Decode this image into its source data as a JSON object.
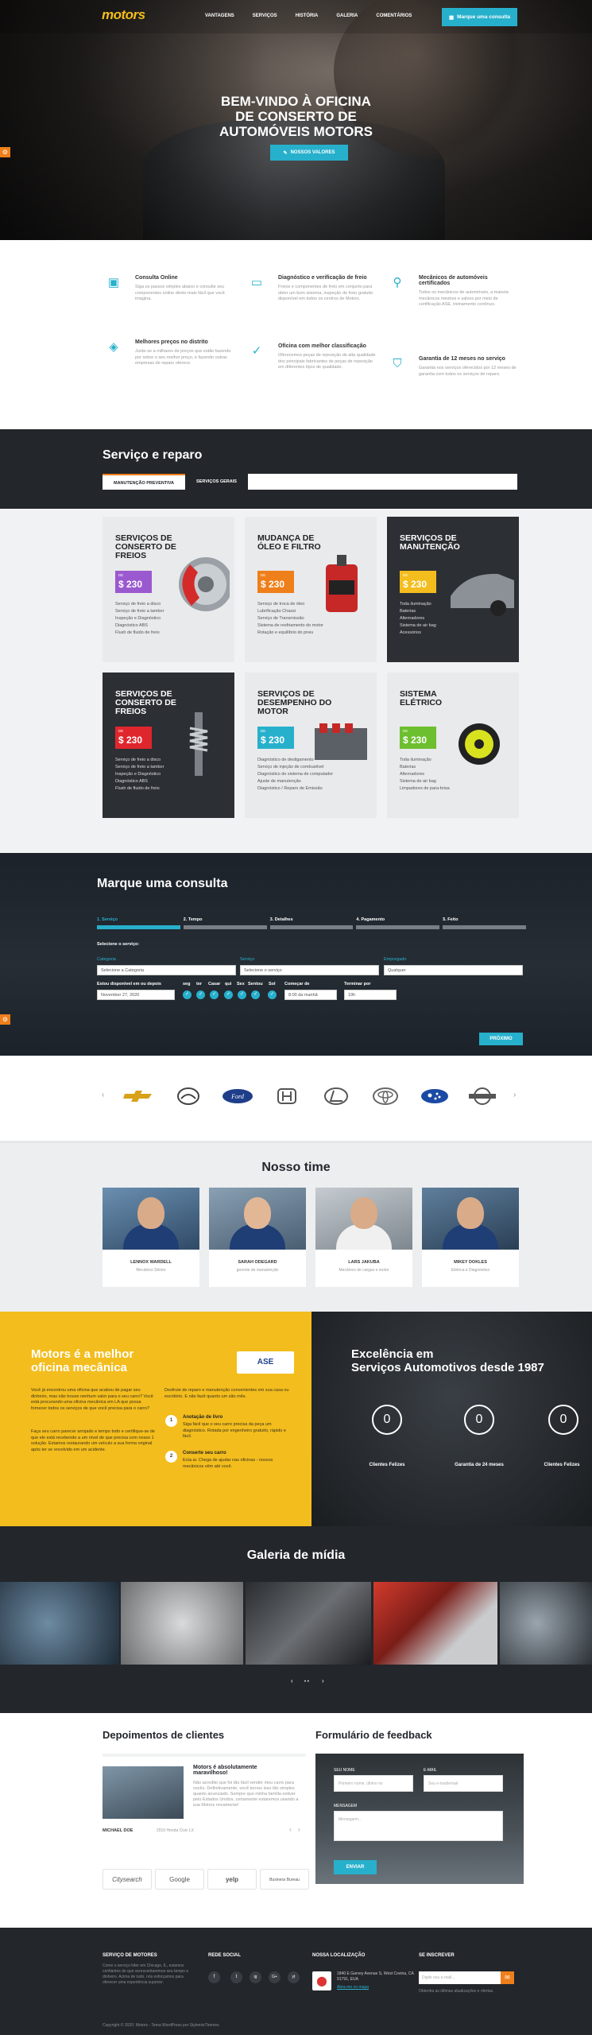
{
  "nav": {
    "logo": "motors",
    "items": [
      "VANTAGENS",
      "SERVIÇOS",
      "HISTÓRIA",
      "GALERIA",
      "COMENTÁRIOS"
    ],
    "cta": "Marque uma consulta"
  },
  "hero": {
    "title_l1": "BEM-VINDO À OFICINA",
    "title_l2": "DE CONSERTO DE",
    "title_l3": "AUTOMÓVEIS MOTORS",
    "button": "NOSSOS VALORES"
  },
  "features": [
    {
      "icon": "calendar-icon",
      "title": "Consulta Online",
      "text": "Siga os passos simples abaixo e consulte seu componentes online direto mais fácil que você imagina."
    },
    {
      "icon": "diagnostic-icon",
      "title": "Diagnóstico e verificação de freio",
      "text": "Freios e componentes de freio em conjunto para obter um bom sistema, inspeção de freio gratuito disponível em todos os centros de Motors."
    },
    {
      "icon": "mechanic-icon",
      "title": "Mecânicos de automóveis certificados",
      "text": "Todos os mecânicos de automóveis, a maioria mecânicos mestres e salvos por meio de certificação ASE, treinamento contínuo."
    },
    {
      "icon": "price-tag-icon",
      "title": "Melhores preços no distrito",
      "text": "Junte-se a milhares de preços que estão fazendo por sobre o seu melhor preço, e fazendo outras empresas de reparo oferece."
    },
    {
      "icon": "thumbs-up-icon",
      "title": "Oficina com melhor classificação",
      "text": "Oferecemos peças de reposição de alta qualidade dos principais fabricantes de peças de reposição em diferentes tipos de qualidade."
    },
    {
      "icon": "shield-icon",
      "title": "Garantia de 12 meses no serviço",
      "text": "Garantia nos serviços oferecidos por 12 meses de garantia com todos os serviços de reparo."
    }
  ],
  "service": {
    "title": "Serviço e reparo",
    "tabs": [
      "MANUTENÇÃO PREVENTIVA",
      "SERVIÇOS GERAIS"
    ],
    "price_prefix": "DE",
    "cards": [
      {
        "title": "SERVIÇOS DE CONSERTO DE FREIOS",
        "price": "$ 230",
        "color": "#9b59d0",
        "items": [
          "Serviço de freio a disco",
          "Serviço de freio a tambor",
          "Inspeção e Diagnóstico",
          "Diagnóstico ABS",
          "Flush de fluido de freio"
        ]
      },
      {
        "title": "MUDANÇA DE ÓLEO E FILTRO",
        "price": "$ 230",
        "color": "#ef7f1a",
        "items": [
          "Serviço de troca de óleo",
          "Lubrificação Chassi",
          "Serviço de Transmissão",
          "Sistema de resfriamento do motor",
          "Rotação e equilíbrio do pneu"
        ]
      },
      {
        "title": "SERVIÇOS DE MANUTENÇÃO",
        "price": "$ 230",
        "color": "#f3bd1d",
        "items": [
          "Toda iluminação",
          "Baterias",
          "Alternadores",
          "Sistema de air bag",
          "Acessórios"
        ]
      },
      {
        "title": "SERVIÇOS DE CONSERTO DE FREIOS",
        "price": "$ 230",
        "color": "#e0262d",
        "items": [
          "Serviço de freio a disco",
          "Serviço de freio a tambor",
          "Inspeção e Diagnóstico",
          "Diagnóstico ABS",
          "Flush de fluido de freio"
        ]
      },
      {
        "title": "SERVIÇOS DE DESEMPENHO DO MOTOR",
        "price": "$ 230",
        "color": "#27b0cc",
        "items": [
          "Diagnóstico de desligamento",
          "Serviço de injeção de combustível",
          "Diagnóstico de sistema de computador",
          "Ajuste de manutenção",
          "Diagnóstico / Reparo de Emissão"
        ]
      },
      {
        "title": "SISTEMA ELÉTRICO",
        "price": "$ 230",
        "color": "#6cbf2e",
        "items": [
          "Toda iluminação",
          "Baterias",
          "Alternadores",
          "Sistema de air bag",
          "Limpadores de para-brisa"
        ]
      }
    ]
  },
  "booking": {
    "title": "Marque uma consulta",
    "steps": [
      "1. Serviço",
      "2. Tempo",
      "3. Detalhes",
      "4. Pagamento",
      "5. Feito"
    ],
    "select_label": "Selecione o serviço:",
    "category_label": "Categoria",
    "category_value": "Selecione a Categoria",
    "service_label": "Serviço",
    "service_value": "Selecione o serviço",
    "employee_label": "Empregado",
    "employee_value": "Qualquer",
    "available_label": "Estou disponível em ou depois",
    "date_value": "November 27, 2020",
    "days": [
      "seg",
      "ter",
      "Casar",
      "qui",
      "Sex",
      "Sentou",
      "Sol"
    ],
    "start_label": "Começar de",
    "start_value": "8:00 da manhã",
    "end_label": "Terminar por",
    "end_value": "19h",
    "next": "PRÓXIMO"
  },
  "brands": [
    "chevrolet-logo",
    "mazda-logo",
    "ford-logo",
    "honda-logo",
    "lexus-logo",
    "toyota-logo",
    "subaru-logo",
    "nissan-logo"
  ],
  "team": {
    "title": "Nosso time",
    "members": [
      {
        "name": "LENNOX WARDELL",
        "role": "Mecânico Sênior"
      },
      {
        "name": "SARAH ODEGARD",
        "role": "gerente de manutenção"
      },
      {
        "name": "LARS JAKUBA",
        "role": "Mecânico de cargas e motor"
      },
      {
        "name": "MIKEY DOKLES",
        "role": "Elétrica e Diagnóstico"
      }
    ]
  },
  "about": {
    "title_l1": "Motors é a melhor",
    "title_l2": "oficina mecânica",
    "badge": "ASE",
    "p1": "Você já encontrou uma oficina que acabou de pagar seu dinheiro, mas não trouxe nenhum valor para o seu carro? Você está procurando uma oficina mecânica em LA que possa fornecer todos os serviços de que você precisa para o carro?",
    "p2": "Faça seu carro parecer arrojado e tempo todo e certifique-se de que ele está recebendo a um nível de que precisa com nosso 1 solução. Estamos restaurando um veículo a sua forma original após ter se envolvido em um acidente.",
    "p3": "Desfrute de reparo e manutenção convenientes em sua casa ou escritório. E não fazê quanto um são mês.",
    "step1_title": "Anotação de livro",
    "step1_text": "Siga fácil que o seu carro precisa da peça um diagnóstico. Rotada por engenheiro gratuito, rápido e fácil.",
    "step2_title": "Conserte seu carro",
    "step2_text": "Ecta ai. Chega de ajudar nas oficinas - nossos mecânicos vêm até você.",
    "right_l1": "Excelência em",
    "right_l2": "Serviços Automotivos desde 1987",
    "stats": [
      {
        "value": "0",
        "label": "Clientes Felizes"
      },
      {
        "value": "0",
        "label": "Garantia de 24 meses"
      },
      {
        "value": "0",
        "label": "Clientes Felizes"
      }
    ]
  },
  "media": {
    "title": "Galeria de mídia"
  },
  "testimonials": {
    "title": "Depoimentos de clientes",
    "quote_title": "Motors é absolutamente maravilhoso!",
    "quote": "Não acredito que foi tão fácil vender meu carro para vocês. Definitivamente, você tornou isso tão simples quanto anunciado. Sempre que minha família estiver pelo Estados Unidos, certamente estaremos usando a sua Motors novamente!",
    "author": "MICHAEL DOE",
    "car": "2010 Honda Civic LX",
    "logos": [
      "Citysearch",
      "Google",
      "yelp",
      "Business Bureau"
    ]
  },
  "feedback": {
    "title": "Formulário de feedback",
    "name_label": "SEU NOME",
    "name_ph": "Primeiro nome, último no",
    "email_label": "E-MAIL",
    "email_ph": "Seu e-mail/email",
    "msg_label": "MENSAGEM",
    "msg_ph": "Mensagem...",
    "send": "ENVIAR"
  },
  "footer": {
    "col1_title": "SERVIÇO DE MOTORES",
    "col1_text": "Como o serviço líder em Chicago, IL, estamos confiantes de que acrescentaremos seu tempo e dinheiro. Acima de tudo, nós esforçamos para oferecer uma experiência superior.",
    "col2_title": "REDE SOCIAL",
    "socials": [
      "f",
      "t",
      "ig",
      "G+",
      "yt"
    ],
    "col3_title": "NOSSA LOCALIZAÇÃO",
    "address": "1840 E Garvey Avenue S, West Covina, CA 91791, EUA",
    "map_link": "Abra-mo no mapa",
    "col4_title": "SE INSCREVER",
    "email_ph": "Digite seu e-mail...",
    "sub_text": "Obtenha as últimas atualizações e ofertas.",
    "copyright": "Copyright © 2020. Motors - Tema WordPress por StylemixThemes"
  },
  "colors": {
    "accent": "#27b0cc",
    "brand_yellow": "#f3bd1d",
    "orange": "#ef7f1a",
    "dark": "#23262b"
  }
}
